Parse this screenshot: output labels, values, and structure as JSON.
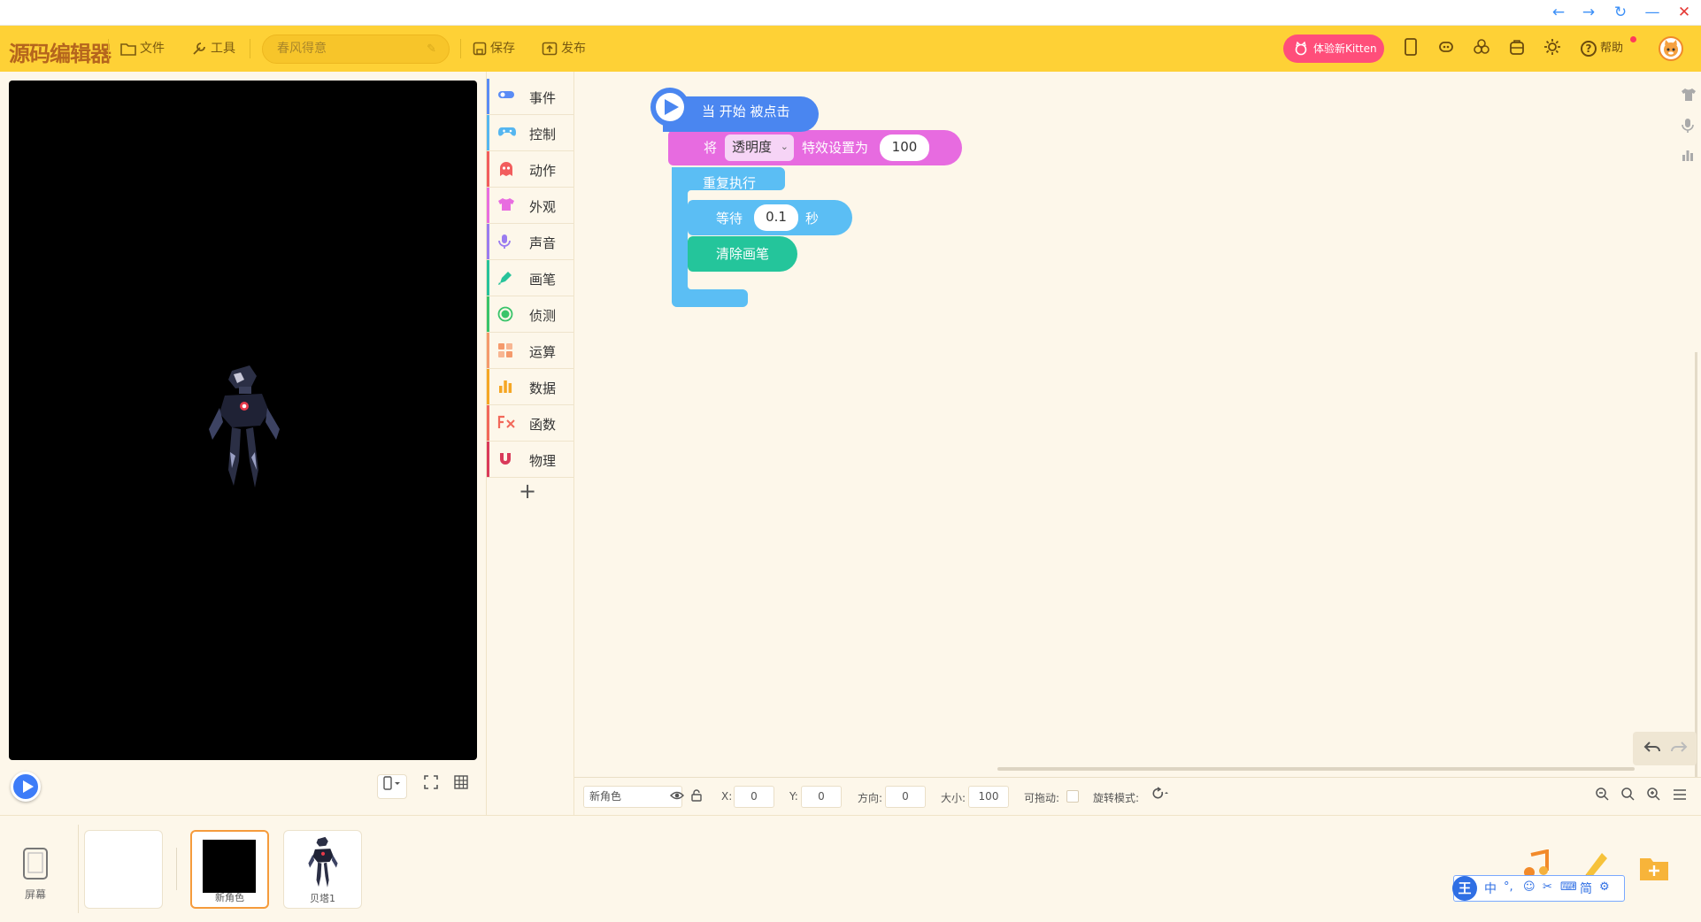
{
  "window": {
    "back_label": "←",
    "forward_label": "→",
    "refresh_label": "↻",
    "minimize_label": "—",
    "close_label": "✕"
  },
  "toolbar": {
    "logo": "源码编辑器",
    "file_label": "文件",
    "tools_label": "工具",
    "project_name": "春风得意",
    "save_label": "保存",
    "publish_label": "发布",
    "kitten_label": "体验新Kitten",
    "help_label": "帮助"
  },
  "categories": [
    {
      "label": "事件",
      "color": "#5a8cf5",
      "icon": "toggle-icon"
    },
    {
      "label": "控制",
      "color": "#55b6f0",
      "icon": "gamepad-icon"
    },
    {
      "label": "动作",
      "color": "#f25d5d",
      "icon": "ghost-icon"
    },
    {
      "label": "外观",
      "color": "#e86de0",
      "icon": "shirt-icon"
    },
    {
      "label": "声音",
      "color": "#9a7cf0",
      "icon": "microphone-icon"
    },
    {
      "label": "画笔",
      "color": "#27c39a",
      "icon": "pen-icon"
    },
    {
      "label": "侦测",
      "color": "#39c46a",
      "icon": "sensor-icon"
    },
    {
      "label": "运算",
      "color": "#f59a6c",
      "icon": "calculator-icon"
    },
    {
      "label": "数据",
      "color": "#f5a623",
      "icon": "bar-chart-icon"
    },
    {
      "label": "函数",
      "color": "#f2685a",
      "icon": "function-icon"
    },
    {
      "label": "物理",
      "color": "#d93a5a",
      "icon": "magnet-icon"
    }
  ],
  "blocks": {
    "hat_label": "当 开始 被点击",
    "set_effect_prefix": "将",
    "set_effect_dropdown": "透明度",
    "set_effect_suffix": "特效设置为",
    "set_effect_value": "100",
    "repeat_label": "重复执行",
    "wait_label": "等待",
    "wait_value": "0.1",
    "wait_unit": "秒",
    "clear_pen_label": "清除画笔"
  },
  "attributes": {
    "sprite_name": "新角色",
    "x_label": "X:",
    "x_value": "0",
    "y_label": "Y:",
    "y_value": "0",
    "direction_label": "方向:",
    "direction_value": "0",
    "size_label": "大小:",
    "size_value": "100",
    "draggable_label": "可拖动:",
    "rotation_label": "旋转模式:"
  },
  "sprites": {
    "screen_label": "屏幕",
    "items": [
      {
        "label": ""
      },
      {
        "label": "新角色"
      },
      {
        "label": "贝塔1"
      }
    ]
  },
  "ime": {
    "logo": "王",
    "lang": "中",
    "simplified": "简"
  },
  "colors": {
    "toolbar_bg": "#fed136",
    "workspace_bg": "#fdf7ea",
    "event_block": "#4a86f0",
    "looks_block": "#e76be0",
    "control_block": "#5bbef4",
    "pen_block": "#24c59b",
    "accent_pink": "#ff4e7a",
    "selected_sprite": "#f59b3c"
  }
}
